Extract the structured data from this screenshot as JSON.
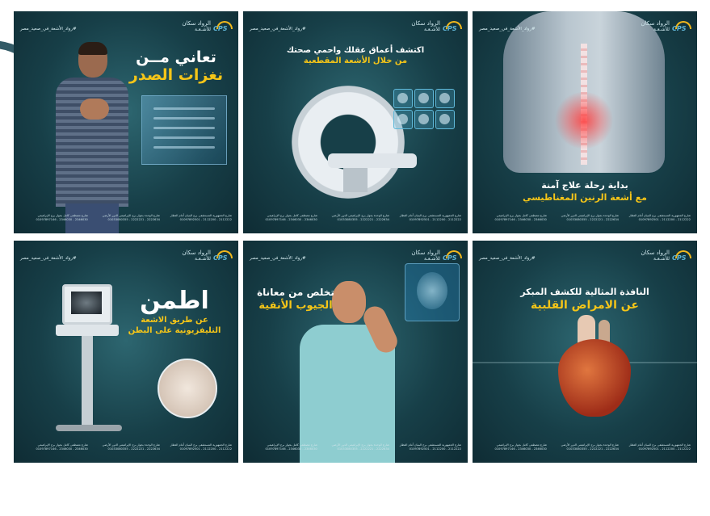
{
  "brand": {
    "name_line1": "الرواد سكان",
    "name_line2": "للأشـعـة",
    "mark_text": "CPS",
    "accent": "#f5c518",
    "mark_blue": "#5fb4d6"
  },
  "tagline": "#رواد_الأشعة_في_صعيد_مصر",
  "footer": {
    "addresses": [
      "شارع الجمهورية المستشفى برج البنيان أمام العطار\n2112222 - 2112200 - 01097892501",
      "شارع الوحدة بجوار برج الإبراهيمي الدور الأرضي\n2222634 - 2222221 - 01033080355",
      "شارع مصطفى كامل بجوار برج الإبراهيمي\n2346030 - 2346030 - 01097897146"
    ]
  },
  "cards": [
    {
      "headline_white": "تعاني مــن",
      "headline_yellow": "نغزات الصدر"
    },
    {
      "headline_white": "اكتشف أعماق عقلك واحمي صحتك",
      "headline_yellow": "من خلال الأشعة المقطعية"
    },
    {
      "headline_white": "بداية رحلة علاج آمنة",
      "headline_yellow": "مع أشعة الرنين المغناطيسي"
    },
    {
      "headline_big": "اطمن",
      "headline_yellow": "عن طريق الاشعة التليفزيونية على البطن"
    },
    {
      "headline_white": "تخلص من معاناة",
      "headline_yellow": "الجيوب الأنفية"
    },
    {
      "headline_white": "النافذة المثالية للكشف المبكر",
      "headline_yellow": "عن الامراض القلبية"
    }
  ]
}
